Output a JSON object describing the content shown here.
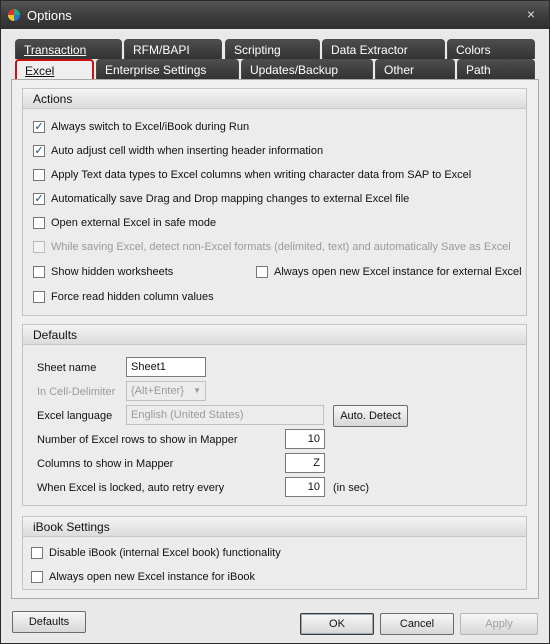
{
  "window": {
    "title": "Options",
    "icon": "colorful-app-icon",
    "close": "×"
  },
  "tabs": {
    "row1": [
      "Transaction",
      "RFM/BAPI",
      "Scripting",
      "Data Extractor",
      "Colors"
    ],
    "row2": [
      "Excel",
      "Enterprise Settings",
      "Updates/Backup",
      "Other",
      "Path"
    ],
    "active": "Excel"
  },
  "actions": {
    "header": "Actions",
    "items": [
      {
        "label": "Always switch to Excel/iBook during Run",
        "checked": true,
        "enabled": true
      },
      {
        "label": "Auto adjust cell width when inserting header information",
        "checked": true,
        "enabled": true
      },
      {
        "label": "Apply Text data types to Excel columns when writing character data from SAP to Excel",
        "checked": false,
        "enabled": true
      },
      {
        "label": "Automatically save Drag and Drop mapping changes to external Excel file",
        "checked": true,
        "enabled": true
      },
      {
        "label": "Open external Excel in safe mode",
        "checked": false,
        "enabled": true
      },
      {
        "label": "While saving Excel, detect non-Excel formats (delimited, text) and automatically Save as Excel",
        "checked": false,
        "enabled": false
      },
      {
        "label": "Show hidden worksheets",
        "checked": false,
        "enabled": true
      },
      {
        "label": "Always open new Excel instance for external Excel",
        "checked": false,
        "enabled": true
      },
      {
        "label": "Force read hidden column values",
        "checked": false,
        "enabled": true
      }
    ]
  },
  "defaults": {
    "header": "Defaults",
    "sheet_name_label": "Sheet name",
    "sheet_name_value": "Sheet1",
    "delimiter_label": "In Cell-Delimiter",
    "delimiter_value": "{Alt+Enter}",
    "excel_language_label": "Excel language",
    "excel_language_value": "English (United States)",
    "auto_detect_label": "Auto. Detect",
    "rows_label": "Number of Excel rows to show in Mapper",
    "rows_value": "10",
    "columns_label": "Columns to show in Mapper",
    "columns_value": "Z",
    "retry_label": "When Excel is locked, auto retry every",
    "retry_value": "10",
    "retry_unit": "(in sec)"
  },
  "ibook": {
    "header": "iBook Settings",
    "items": [
      {
        "label": "Disable iBook (internal Excel book) functionality",
        "checked": false
      },
      {
        "label": "Always open new Excel instance for iBook",
        "checked": false
      }
    ]
  },
  "footer": {
    "defaults": "Defaults",
    "ok": "OK",
    "cancel": "Cancel",
    "apply": "Apply"
  }
}
